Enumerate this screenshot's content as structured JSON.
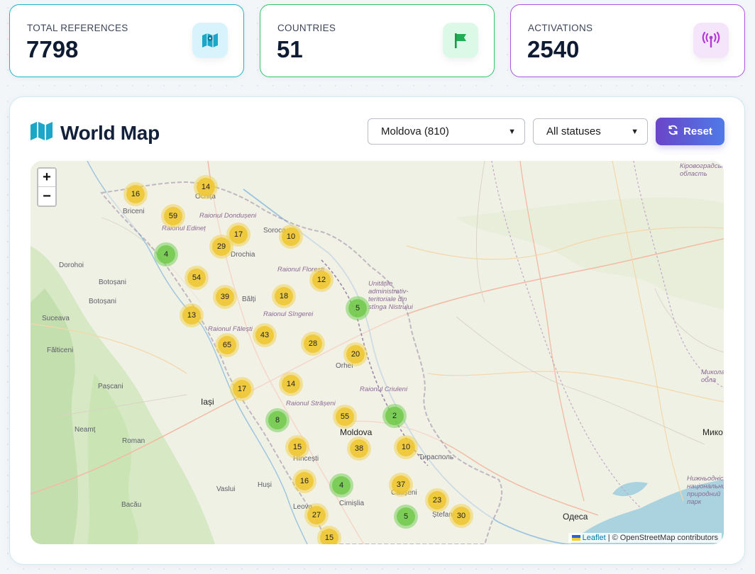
{
  "stats": [
    {
      "label": "TOTAL REFERENCES",
      "value": "7798",
      "icon": "map-icon",
      "accent": "#1fb5c9"
    },
    {
      "label": "COUNTRIES",
      "value": "51",
      "icon": "flag-icon",
      "accent": "#31c46b"
    },
    {
      "label": "ACTIVATIONS",
      "value": "2540",
      "icon": "antenna-icon",
      "accent": "#a957e0"
    }
  ],
  "panel": {
    "title": "World Map",
    "country_select": "Moldova (810)",
    "status_select": "All statuses",
    "reset_label": "Reset"
  },
  "map": {
    "zoom_in": "+",
    "zoom_out": "−",
    "attribution_leaflet": "Leaflet",
    "attribution_rest": "| © OpenStreetMap contributors",
    "clusters": [
      "16",
      "14",
      "59",
      "17",
      "10",
      "29",
      "4",
      "54",
      "12",
      "39",
      "18",
      "13",
      "5",
      "43",
      "65",
      "28",
      "20",
      "17",
      "14",
      "55",
      "2",
      "8",
      "15",
      "38",
      "10",
      "16",
      "4",
      "37",
      "23",
      "27",
      "5",
      "30",
      "15"
    ],
    "places": {
      "briceni": "Briceni",
      "ocnita": "Ocnița",
      "donduseni": "Raionul Dondușeni",
      "edinet": "Raionul Edineț",
      "soroca": "Soroca",
      "drochia": "Drochia",
      "dorohoi": "Dorohoi",
      "botosani1": "Botoșani",
      "botosani2": "Botoșani",
      "floresti": "Raionul Florești",
      "balti": "Bălți",
      "singerei": "Raionul Sîngerei",
      "suceava": "Suceava",
      "falesti": "Raionul Fălești",
      "transnistria": "Unitățile administrativ-teritoriale din stînga Nistrului",
      "falticeni": "Fălticeni",
      "orhei": "Orhei",
      "pascani": "Pașcani",
      "iasi": "Iași",
      "straseni": "Raionul Strășeni",
      "criuleni": "Raionul Criuleni",
      "moldova": "Moldova",
      "neamt": "Neamț",
      "roman": "Roman",
      "hincesti": "Hîncești",
      "tiraspol": "Тирасполь",
      "vaslui": "Vaslui",
      "husi": "Huși",
      "cimislia": "Cimișlia",
      "causeni": "Căușeni",
      "bacau": "Bacău",
      "leova": "Leova",
      "stefan": "Ștefan",
      "odesa": "Одеса",
      "kirovohrad": "Кіровоградська область",
      "mykolaiv": "Микола обла",
      "myko": "Мико",
      "nyzhnodnist": "Нижньодністровський національний природний парк"
    }
  }
}
